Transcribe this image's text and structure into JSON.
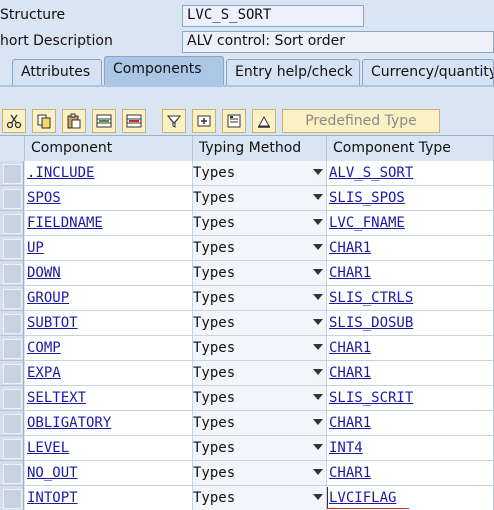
{
  "header": {
    "structure_label": "Structure",
    "structure_value": "LVC_S_SORT",
    "shortdesc_label": "hort Description",
    "shortdesc_value": "ALV control: Sort order"
  },
  "tabs": [
    {
      "label": "Attributes",
      "active": false
    },
    {
      "label": "Components",
      "active": true
    },
    {
      "label": "Entry help/check",
      "active": false
    },
    {
      "label": "Currency/quantity",
      "active": false
    }
  ],
  "toolbar": {
    "icons": [
      "cut-icon",
      "copy-icon",
      "paste-icon",
      "insert-row-icon",
      "delete-row-icon",
      "filter-icon",
      "add-field-icon",
      "details-icon",
      "sort-icon"
    ],
    "predefined_label": "Predefined Type"
  },
  "grid": {
    "columns": [
      "Component",
      "Typing Method",
      "Component Type"
    ],
    "rows": [
      {
        "component": ".INCLUDE",
        "typing": "Types",
        "ctype": "ALV_S_SORT"
      },
      {
        "component": "SPOS",
        "typing": "Types",
        "ctype": "SLIS_SPOS"
      },
      {
        "component": "FIELDNAME",
        "typing": "Types",
        "ctype": "LVC_FNAME"
      },
      {
        "component": "UP",
        "typing": "Types",
        "ctype": "CHAR1"
      },
      {
        "component": "DOWN",
        "typing": "Types",
        "ctype": "CHAR1"
      },
      {
        "component": "GROUP",
        "typing": "Types",
        "ctype": "SLIS_CTRLS"
      },
      {
        "component": "SUBTOT",
        "typing": "Types",
        "ctype": "SLIS_DOSUB"
      },
      {
        "component": "COMP",
        "typing": "Types",
        "ctype": "CHAR1"
      },
      {
        "component": "EXPA",
        "typing": "Types",
        "ctype": "CHAR1"
      },
      {
        "component": "SELTEXT",
        "typing": "Types",
        "ctype": "SLIS_SCRIT"
      },
      {
        "component": "OBLIGATORY",
        "typing": "Types",
        "ctype": "CHAR1"
      },
      {
        "component": "LEVEL",
        "typing": "Types",
        "ctype": "INT4"
      },
      {
        "component": "NO_OUT",
        "typing": "Types",
        "ctype": "CHAR1"
      },
      {
        "component": "INTOPT",
        "typing": "Types",
        "ctype": "LVCIFLAG"
      }
    ]
  }
}
